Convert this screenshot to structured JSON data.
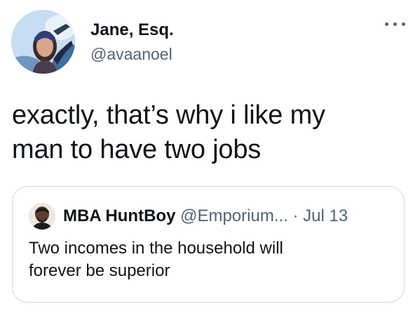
{
  "author": {
    "name": "Jane, Esq.",
    "handle": "@avaanoel",
    "avatar_icon": "profile-photo"
  },
  "menu": {
    "icon": "more-horizontal-icon"
  },
  "tweet": {
    "text_line1": "exactly, that’s why i like my",
    "text_line2": "man to have two jobs"
  },
  "quoted_tweet": {
    "author_name": "MBA HuntBoy",
    "author_handle": "@Emporium...",
    "separator": "·",
    "date": "Jul 13",
    "text_line1": "Two incomes in the household will",
    "text_line2": "forever be superior"
  },
  "colors": {
    "text_primary": "#0f1419",
    "text_secondary": "#536471",
    "border": "#cfd9de",
    "background": "#ffffff"
  }
}
